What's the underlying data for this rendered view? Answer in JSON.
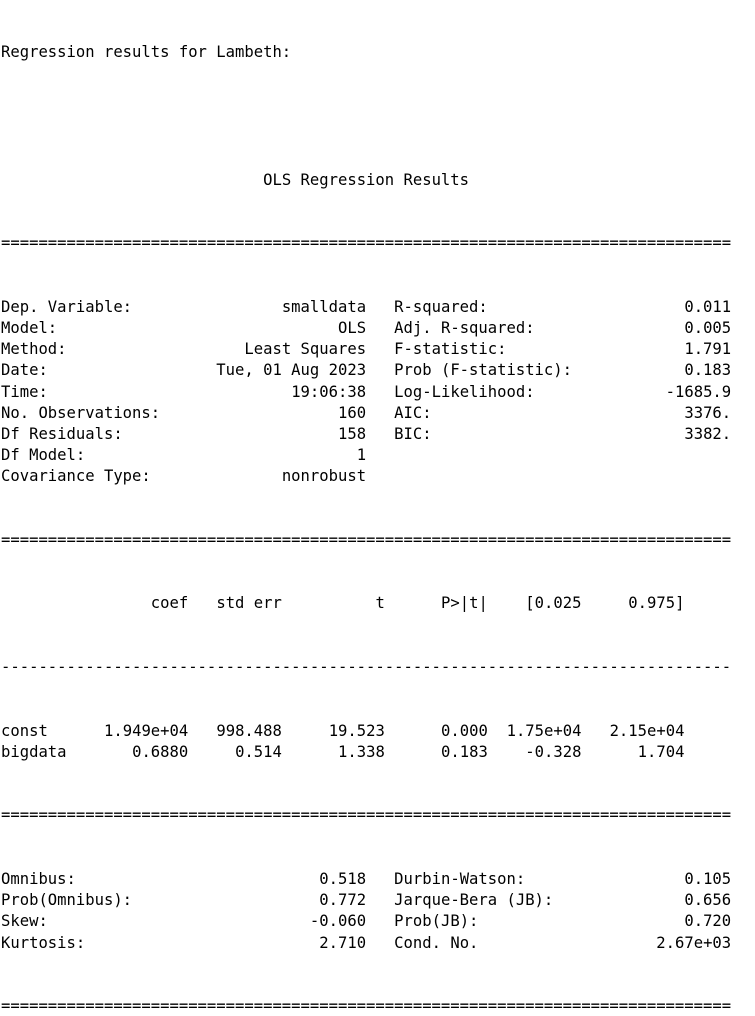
{
  "header": "Regression results for Lambeth:",
  "title": "OLS Regression Results",
  "rules": {
    "double": "==============================================================================",
    "single": "------------------------------------------------------------------------------"
  },
  "model_info": [
    {
      "l_label": "Dep. Variable:",
      "l_value": "smalldata",
      "r_label": "R-squared:",
      "r_value": "0.011"
    },
    {
      "l_label": "Model:",
      "l_value": "OLS",
      "r_label": "Adj. R-squared:",
      "r_value": "0.005"
    },
    {
      "l_label": "Method:",
      "l_value": "Least Squares",
      "r_label": "F-statistic:",
      "r_value": "1.791"
    },
    {
      "l_label": "Date:",
      "l_value": "Tue, 01 Aug 2023",
      "r_label": "Prob (F-statistic):",
      "r_value": "0.183"
    },
    {
      "l_label": "Time:",
      "l_value": "19:06:38",
      "r_label": "Log-Likelihood:",
      "r_value": "-1685.9"
    },
    {
      "l_label": "No. Observations:",
      "l_value": "160",
      "r_label": "AIC:",
      "r_value": "3376."
    },
    {
      "l_label": "Df Residuals:",
      "l_value": "158",
      "r_label": "BIC:",
      "r_value": "3382."
    },
    {
      "l_label": "Df Model:",
      "l_value": "1",
      "r_label": "",
      "r_value": ""
    },
    {
      "l_label": "Covariance Type:",
      "l_value": "nonrobust",
      "r_label": "",
      "r_value": ""
    }
  ],
  "coef_table": {
    "headers": [
      "",
      "coef",
      "std err",
      "t",
      "P>|t|",
      "[0.025",
      "0.975]"
    ],
    "rows": [
      [
        "const",
        "1.949e+04",
        "998.488",
        "19.523",
        "0.000",
        "1.75e+04",
        "2.15e+04"
      ],
      [
        "bigdata",
        "0.6880",
        "0.514",
        "1.338",
        "0.183",
        "-0.328",
        "1.704"
      ]
    ]
  },
  "diagnostics": [
    {
      "l_label": "Omnibus:",
      "l_value": "0.518",
      "r_label": "Durbin-Watson:",
      "r_value": "0.105"
    },
    {
      "l_label": "Prob(Omnibus):",
      "l_value": "0.772",
      "r_label": "Jarque-Bera (JB):",
      "r_value": "0.656"
    },
    {
      "l_label": "Skew:",
      "l_value": "-0.060",
      "r_label": "Prob(JB):",
      "r_value": "0.720"
    },
    {
      "l_label": "Kurtosis:",
      "l_value": "2.710",
      "r_label": "Cond. No.",
      "r_value": "2.67e+03"
    }
  ]
}
